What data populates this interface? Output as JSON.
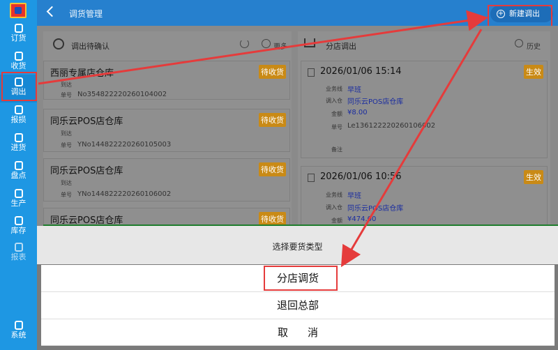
{
  "sidebar": {
    "items": [
      {
        "label": "订货",
        "icon": "order-icon"
      },
      {
        "label": "收货",
        "icon": "receive-icon"
      },
      {
        "label": "调出",
        "icon": "transfer-out-icon"
      },
      {
        "label": "报损",
        "icon": "loss-report-icon"
      },
      {
        "label": "进货",
        "icon": "purchase-icon"
      },
      {
        "label": "盘点",
        "icon": "inventory-check-icon"
      },
      {
        "label": "生产",
        "icon": "production-icon"
      },
      {
        "label": "库存",
        "icon": "stock-icon"
      },
      {
        "label": "报表",
        "icon": "report-icon"
      },
      {
        "label": "系统",
        "icon": "system-icon"
      }
    ],
    "active": "调出"
  },
  "header": {
    "title": "调货管理",
    "new_button": "新建调出"
  },
  "left_panel": {
    "title": "调出待确认",
    "more": "更多",
    "cards": [
      {
        "store": "西丽专属店仓库",
        "status": "待收货",
        "arrive_label": "到达",
        "number_label": "单号",
        "number": "No354822220260104002"
      },
      {
        "store": "同乐云POS店仓库",
        "status": "待收货",
        "arrive_label": "到达",
        "number_label": "单号",
        "number": "YNo144822220260105003"
      },
      {
        "store": "同乐云POS店仓库",
        "status": "待收货",
        "arrive_label": "到达",
        "number_label": "单号",
        "number": "YNo144822220260106002"
      },
      {
        "store": "同乐云POS店仓库",
        "status": "待收货"
      }
    ]
  },
  "right_panel": {
    "title": "分店调出",
    "history": "历史",
    "cards": [
      {
        "datetime": "2026/01/06 15:14",
        "status": "生效",
        "line_label": "业务线",
        "line": "早班",
        "dest_label": "调入仓",
        "dest": "同乐云POS店仓库",
        "amount_label": "金额",
        "amount": "¥8.00",
        "number_label": "单号",
        "number": "Le136122220260106002",
        "remark_label": "备注"
      },
      {
        "datetime": "2026/01/06 10:56",
        "status": "生效",
        "line_label": "业务线",
        "line": "早班",
        "dest_label": "调入仓",
        "dest": "同乐云POS店仓库",
        "amount_label": "金额",
        "amount": "¥474.00"
      }
    ]
  },
  "sheet": {
    "title": "选择要货类型",
    "options": [
      "分店调货",
      "退回总部"
    ],
    "cancel": "取消"
  },
  "colors": {
    "header": "#2680ce",
    "sidebar": "#1e97e3",
    "highlight": "#e53b3b",
    "badge": "#c98a16"
  }
}
